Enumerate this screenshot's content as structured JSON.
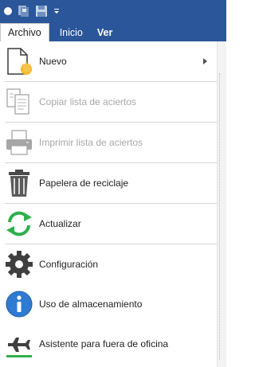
{
  "quick_access": {
    "icons": [
      "circle-icon",
      "save-all-icon",
      "save-icon",
      "customize-dropdown-icon"
    ]
  },
  "tabs": [
    {
      "label": "Archivo",
      "active": true
    },
    {
      "label": "Inicio",
      "active": false
    },
    {
      "label": "Ver",
      "active": false
    }
  ],
  "menu": {
    "items": [
      {
        "label": "Nuevo",
        "icon": "new-document-icon",
        "enabled": true,
        "has_submenu": true
      },
      {
        "label": "Copiar lista de aciertos",
        "icon": "copy-list-icon",
        "enabled": false
      },
      {
        "label": "Imprimir lista de aciertos",
        "icon": "print-icon",
        "enabled": false
      },
      {
        "label": "Papelera de reciclaje",
        "icon": "trash-icon",
        "enabled": true
      },
      {
        "label": "Actualizar",
        "icon": "refresh-icon",
        "enabled": true
      },
      {
        "label": "Configuración",
        "icon": "gear-icon",
        "enabled": true
      },
      {
        "label": "Uso de almacenamiento",
        "icon": "info-icon",
        "enabled": true
      },
      {
        "label": "Asistente para fuera de oficina",
        "icon": "airplane-icon",
        "enabled": true
      }
    ]
  },
  "colors": {
    "title_bar": "#2b579a",
    "green": "#2db04b",
    "info_blue": "#2f7bd1",
    "disabled_text": "#a8a8a8"
  }
}
